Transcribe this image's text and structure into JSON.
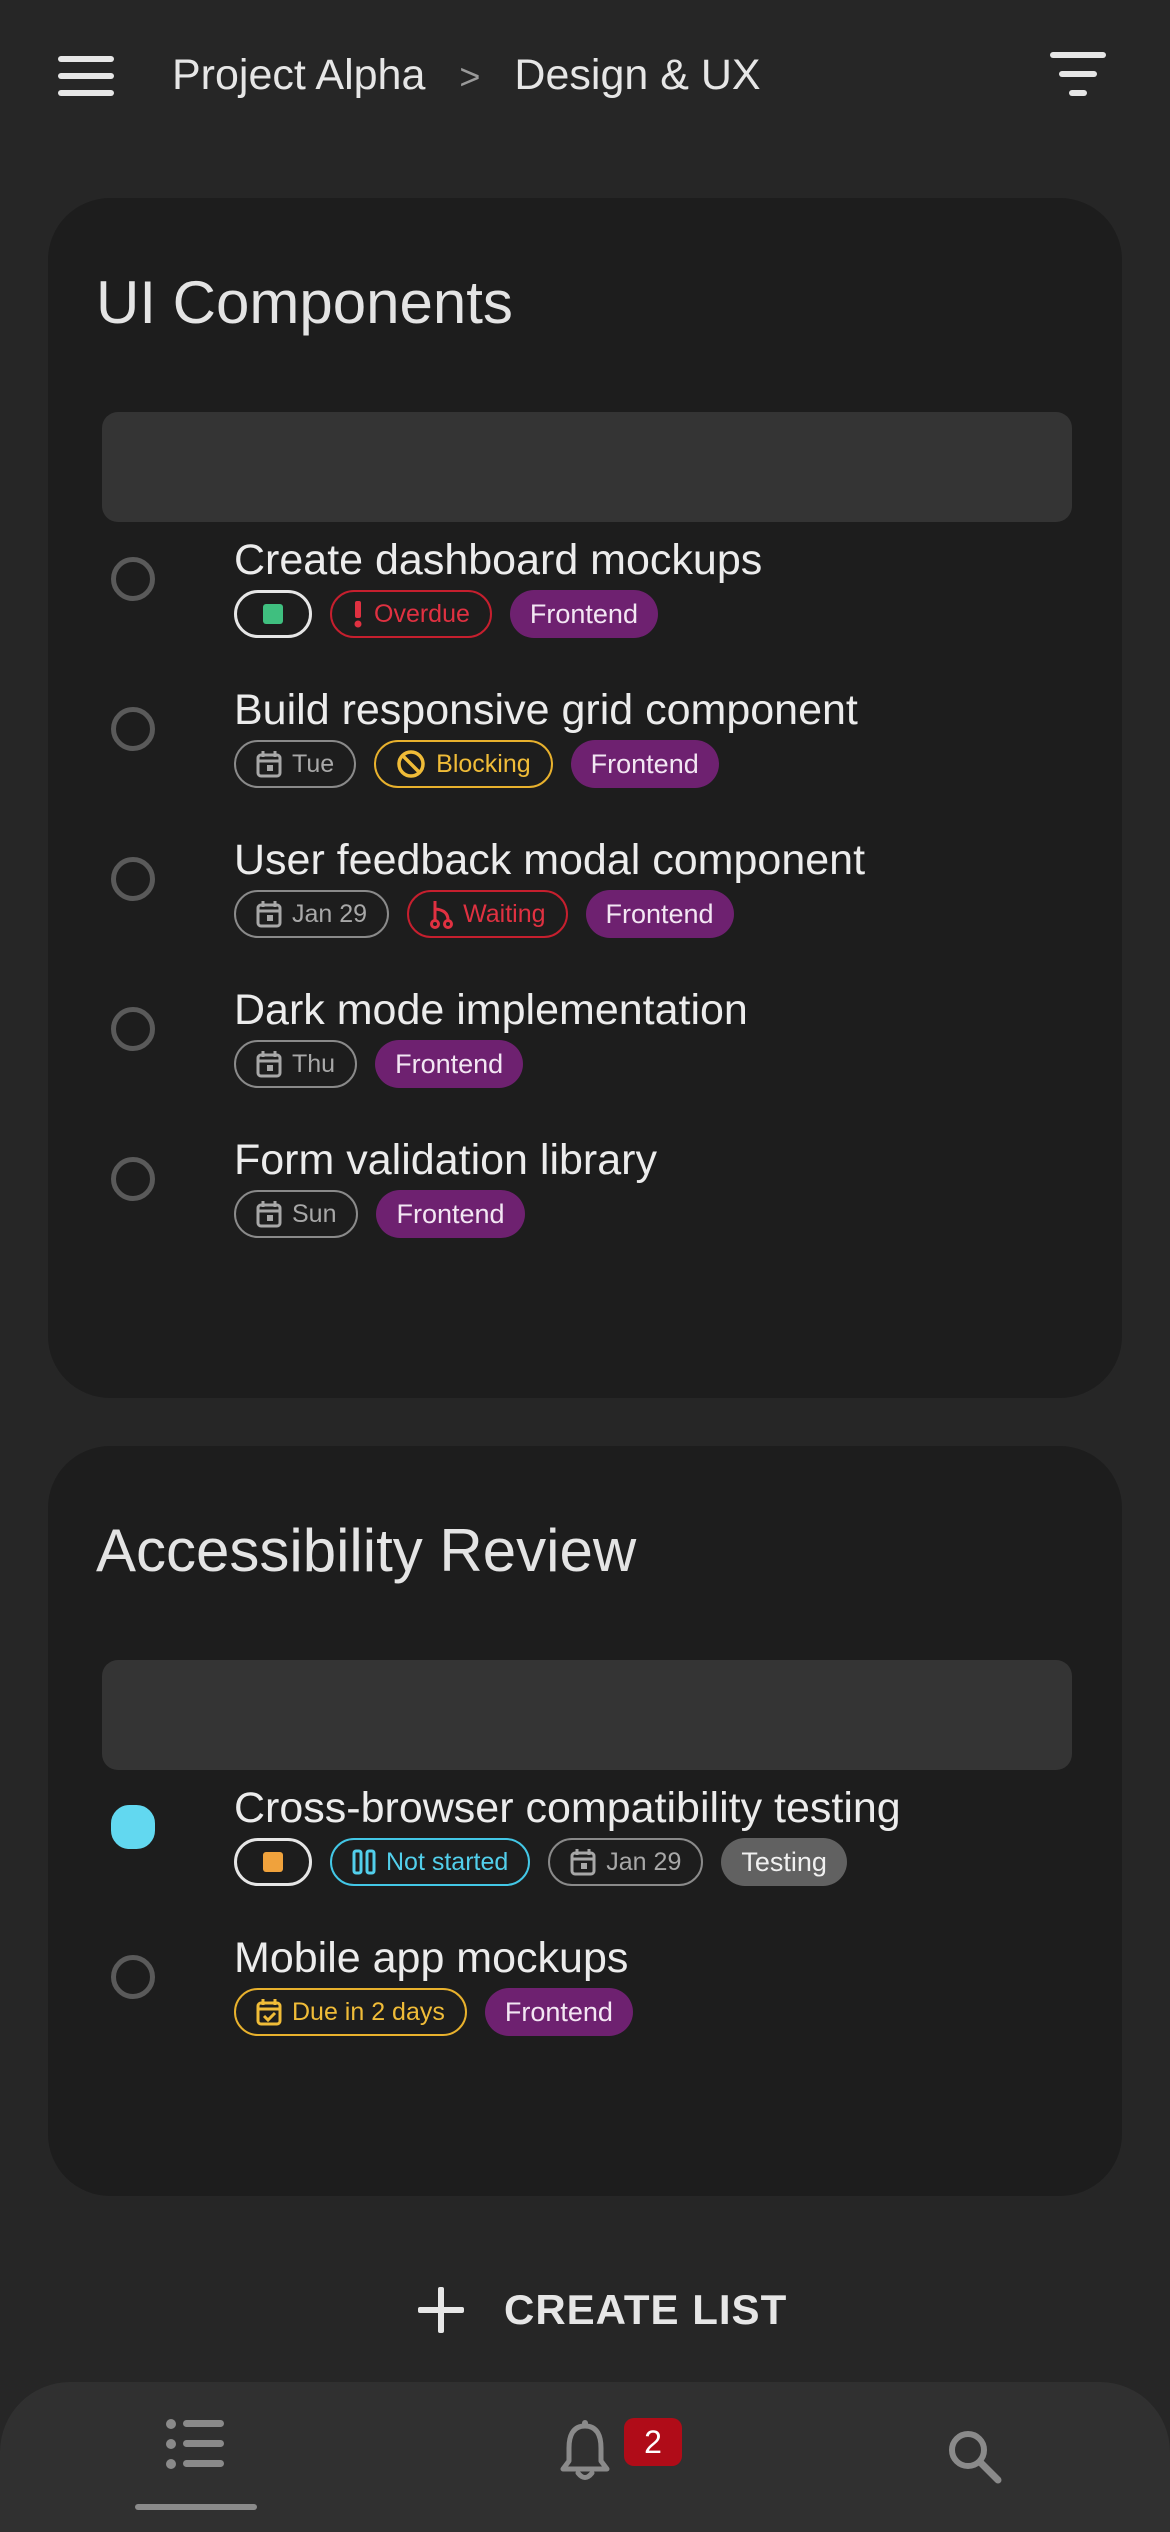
{
  "header": {
    "breadcrumb": [
      "Project Alpha",
      "Design & UX"
    ],
    "separator": ">"
  },
  "lists": [
    {
      "title": "UI Components",
      "tasks": [
        {
          "title": "Create dashboard mockups",
          "completed": false,
          "chips": [
            {
              "kind": "color",
              "color": "#3fbf7f"
            },
            {
              "kind": "status",
              "icon": "exclamation-icon",
              "label": "Overdue",
              "tone": "red"
            },
            {
              "kind": "tag",
              "label": "Frontend"
            }
          ]
        },
        {
          "title": "Build responsive grid component",
          "completed": false,
          "chips": [
            {
              "kind": "date",
              "icon": "calendar-icon",
              "label": "Tue"
            },
            {
              "kind": "status",
              "icon": "blocked-icon",
              "label": "Blocking",
              "tone": "amber"
            },
            {
              "kind": "tag",
              "label": "Frontend"
            }
          ]
        },
        {
          "title": "User feedback modal component",
          "completed": false,
          "chips": [
            {
              "kind": "date",
              "icon": "calendar-icon",
              "label": "Jan 29"
            },
            {
              "kind": "status",
              "icon": "branch-icon",
              "label": "Waiting",
              "tone": "red"
            },
            {
              "kind": "tag",
              "label": "Frontend"
            }
          ]
        },
        {
          "title": "Dark mode implementation",
          "completed": false,
          "chips": [
            {
              "kind": "date",
              "icon": "calendar-icon",
              "label": "Thu"
            },
            {
              "kind": "tag",
              "label": "Frontend"
            }
          ]
        },
        {
          "title": "Form validation library",
          "completed": false,
          "chips": [
            {
              "kind": "date",
              "icon": "calendar-icon",
              "label": "Sun"
            },
            {
              "kind": "tag",
              "label": "Frontend"
            }
          ]
        }
      ]
    },
    {
      "title": "Accessibility Review",
      "tasks": [
        {
          "title": "Cross-browser compatibility testing",
          "completed": true,
          "chips": [
            {
              "kind": "color",
              "color": "#f0a23c"
            },
            {
              "kind": "status",
              "icon": "pause-icon",
              "label": "Not started",
              "tone": "cyan"
            },
            {
              "kind": "date",
              "icon": "calendar-icon",
              "label": "Jan 29"
            },
            {
              "kind": "tag",
              "label": "Testing",
              "tone": "grey"
            }
          ]
        },
        {
          "title": "Mobile app mockups",
          "completed": false,
          "chips": [
            {
              "kind": "status",
              "icon": "calendar-check-icon",
              "label": "Due in 2 days",
              "tone": "amber"
            },
            {
              "kind": "tag",
              "label": "Frontend"
            }
          ]
        }
      ]
    }
  ],
  "create_list_label": "CREATE LIST",
  "bottom_nav": {
    "items": [
      {
        "name": "lists",
        "icon": "list-icon",
        "active": true
      },
      {
        "name": "notifications",
        "icon": "bell-icon",
        "badge": "2"
      },
      {
        "name": "search",
        "icon": "search-icon"
      }
    ]
  },
  "colors": {
    "background": "#262626",
    "card": "#1d1d1d",
    "tag_frontend": "#6e2170",
    "accent_cyan": "#62d8f0",
    "danger": "#c61f2e",
    "warning": "#e8b12d",
    "badge": "#b00c18"
  }
}
